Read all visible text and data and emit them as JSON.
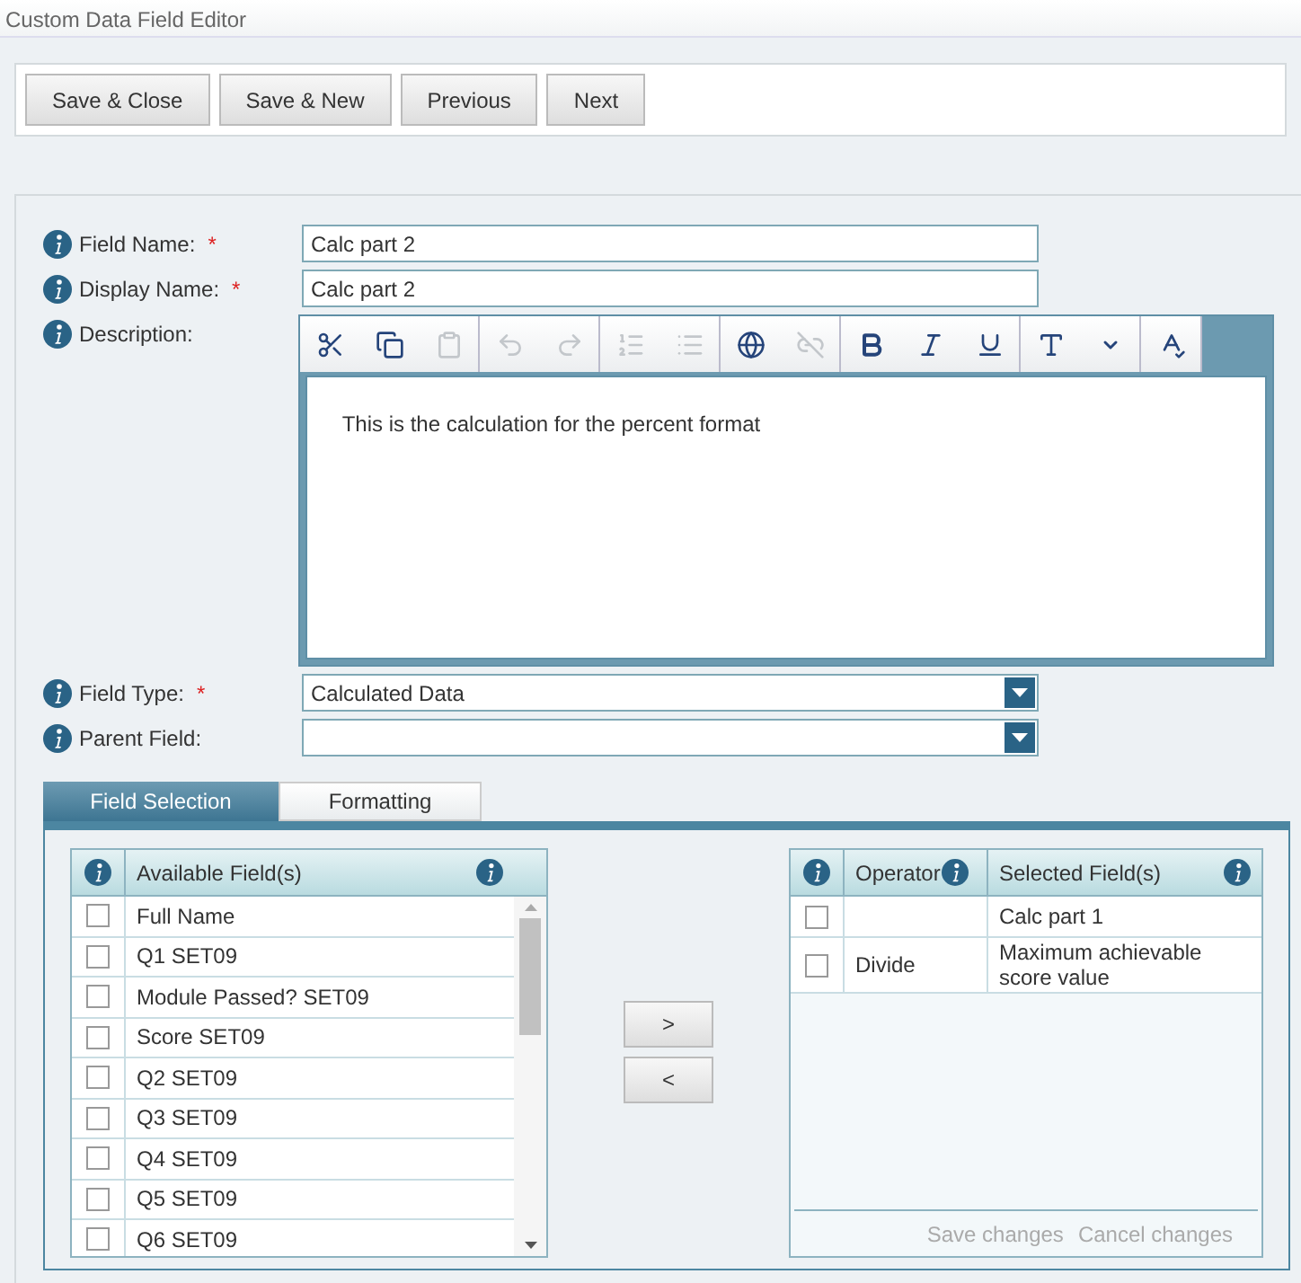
{
  "window": {
    "title": "Custom Data Field Editor"
  },
  "toolbar": [
    "Save & Close",
    "Save & New",
    "Previous",
    "Next"
  ],
  "fields": [
    {
      "kind": "text",
      "label": "Field Name:",
      "required_mark": "*",
      "value": "Calc part 2"
    },
    {
      "kind": "text",
      "label": "Display Name:",
      "required_mark": "*",
      "value": "Calc part 2"
    },
    {
      "kind": "editor",
      "label": "Description:",
      "value": "This is the calculation for the percent format"
    },
    {
      "kind": "select",
      "label": "Field Type:",
      "required_mark": "*",
      "value": "Calculated Data"
    },
    {
      "kind": "select",
      "label": "Parent Field:"
    }
  ],
  "editor_tool_groups": [
    [
      {
        "kind": "cut",
        "disabled": false
      },
      {
        "kind": "copy",
        "disabled": false
      },
      {
        "kind": "paste",
        "disabled": true
      }
    ],
    [
      {
        "kind": "undo",
        "disabled": true
      },
      {
        "kind": "redo",
        "disabled": true
      }
    ],
    [
      {
        "kind": "ordered-list",
        "disabled": true
      },
      {
        "kind": "bullet-list",
        "disabled": true
      }
    ],
    [
      {
        "kind": "link",
        "disabled": false
      },
      {
        "kind": "unlink",
        "disabled": true
      }
    ],
    [
      {
        "kind": "bold",
        "disabled": false
      },
      {
        "kind": "italic",
        "disabled": false
      },
      {
        "kind": "underline",
        "disabled": false
      }
    ],
    [
      {
        "kind": "font-color",
        "disabled": false
      },
      {
        "kind": "dropdown",
        "disabled": false
      }
    ],
    [
      {
        "kind": "spellcheck",
        "disabled": false
      }
    ]
  ],
  "tabs": [
    {
      "label": "Field Selection",
      "selected": true
    },
    {
      "label": "Formatting",
      "selected": false
    }
  ],
  "available": {
    "column": "Available Field(s)",
    "rows": [
      {
        "name": "Full Name",
        "checked": false
      },
      {
        "name": "Q1 SET09",
        "checked": false
      },
      {
        "name": "Module Passed? SET09",
        "checked": false
      },
      {
        "name": "Score SET09",
        "checked": false
      },
      {
        "name": "Q2 SET09",
        "checked": false
      },
      {
        "name": "Q3 SET09",
        "checked": false
      },
      {
        "name": "Q4 SET09",
        "checked": false
      },
      {
        "name": "Q5 SET09",
        "checked": false
      },
      {
        "name": "Q6 SET09",
        "checked": false
      }
    ]
  },
  "move_buttons": [
    ">",
    "<"
  ],
  "selected": {
    "columns": [
      "Operator",
      "Selected Field(s)"
    ],
    "rows": [
      {
        "field": "Calc part 1",
        "checked": false
      },
      {
        "operator": "Divide",
        "field": "Maximum achievable score value",
        "checked": false
      }
    ],
    "footer": [
      "Save changes",
      "Cancel changes"
    ]
  }
}
